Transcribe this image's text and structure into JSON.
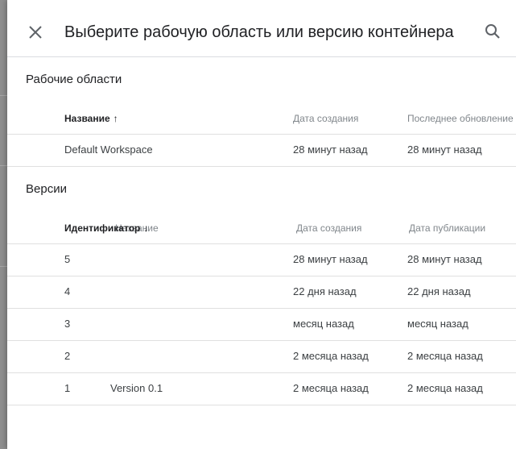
{
  "dialog": {
    "title": "Выберите рабочую область или версию контейнера"
  },
  "workspaces": {
    "section_title": "Рабочие области",
    "columns": {
      "name": "Название",
      "created": "Дата создания",
      "updated": "Последнее обновление"
    },
    "sort_indicator": "↑",
    "rows": [
      {
        "name": "Default Workspace",
        "created": "28 минут назад",
        "updated": "28 минут назад"
      }
    ]
  },
  "versions": {
    "section_title": "Версии",
    "columns": {
      "id": "Идентификатор",
      "name": "Название",
      "created": "Дата создания",
      "published": "Дата публикации"
    },
    "sort_indicator": "↓",
    "rows": [
      {
        "id": "5",
        "name": "",
        "created": "28 минут назад",
        "published": "28 минут назад"
      },
      {
        "id": "4",
        "name": "",
        "created": "22 дня назад",
        "published": "22 дня назад"
      },
      {
        "id": "3",
        "name": "",
        "created": "месяц назад",
        "published": "месяц назад"
      },
      {
        "id": "2",
        "name": "",
        "created": "2 месяца назад",
        "published": "2 месяца назад"
      },
      {
        "id": "1",
        "name": "Version 0.1",
        "created": "2 месяца назад",
        "published": "2 месяца назад"
      }
    ]
  }
}
